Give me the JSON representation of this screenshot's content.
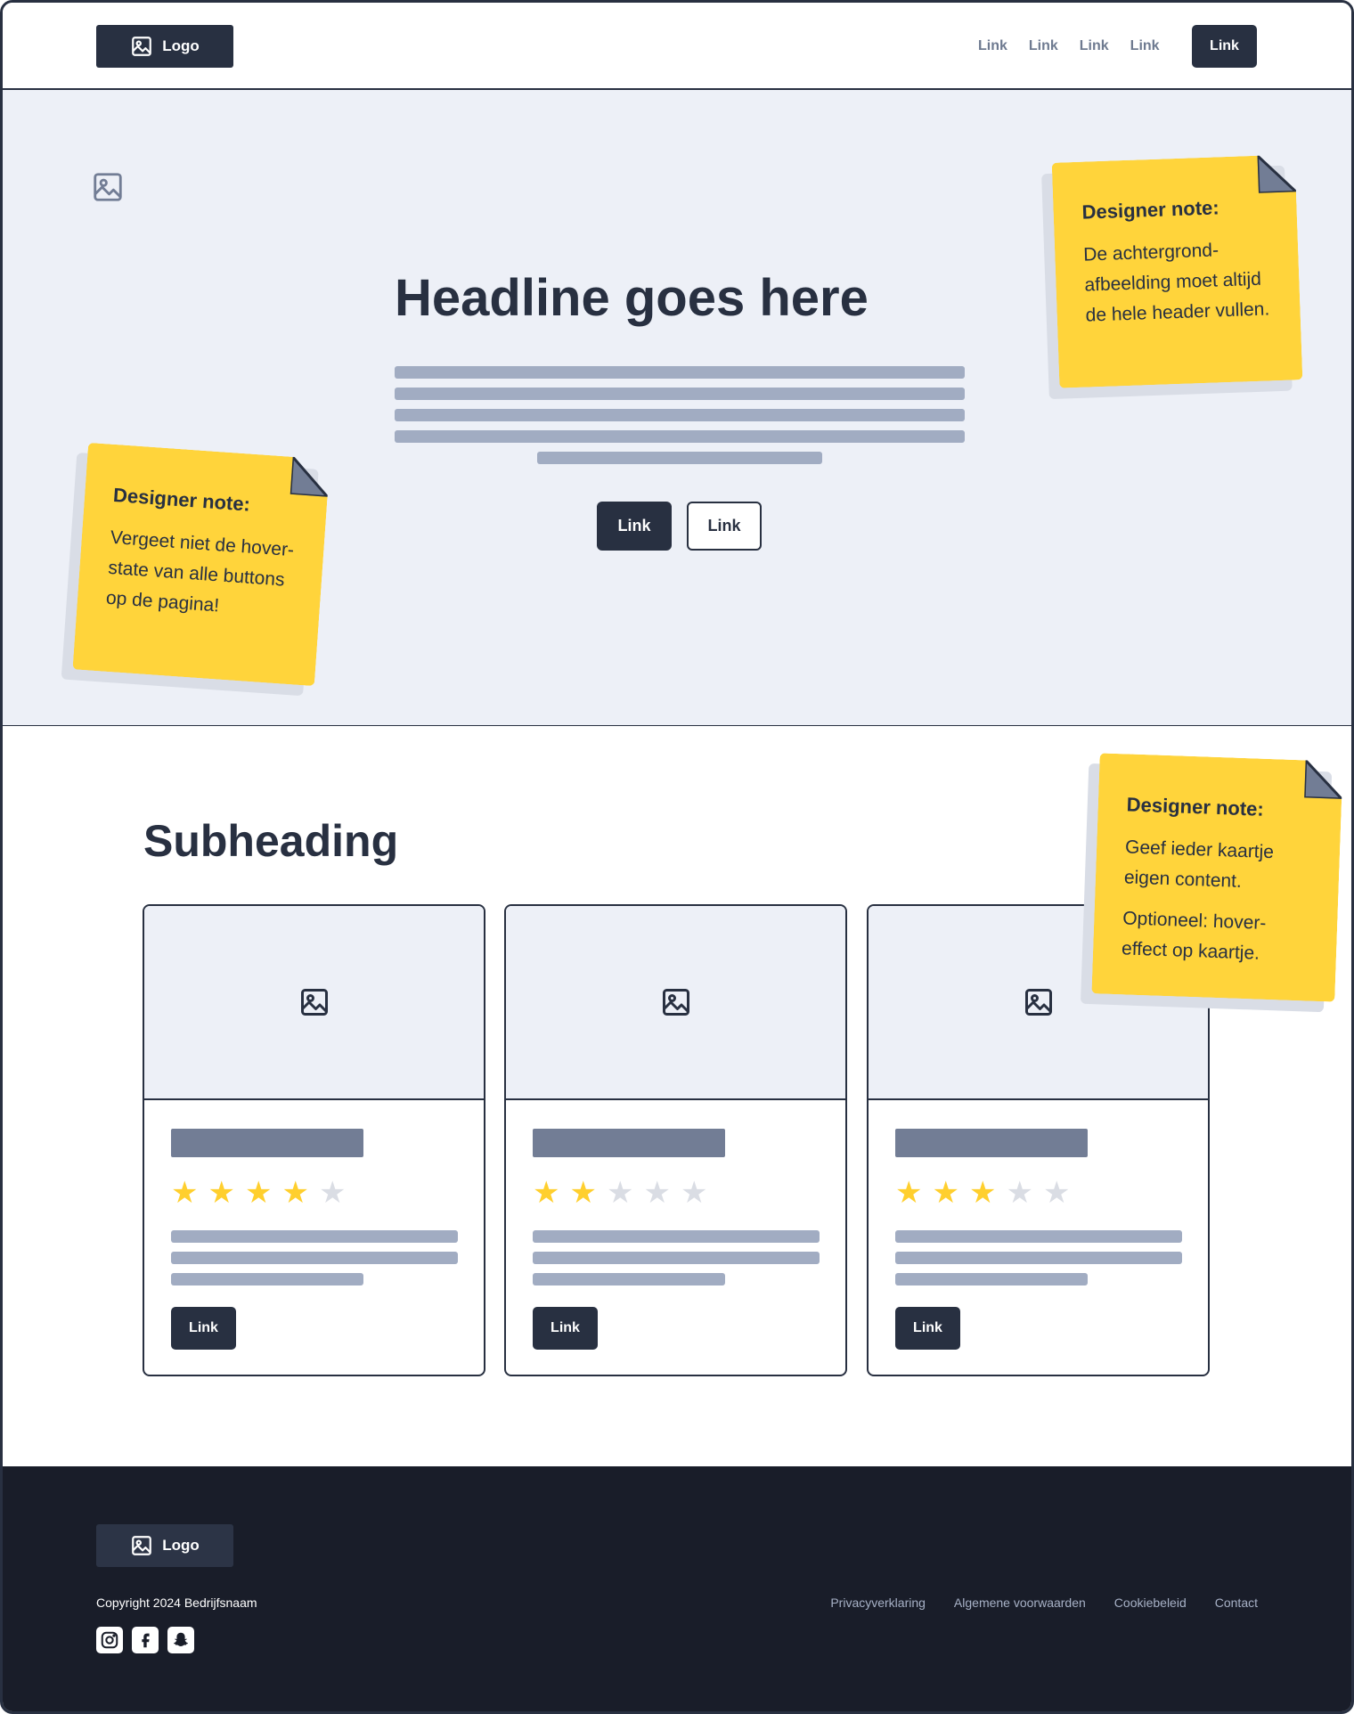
{
  "nav": {
    "logo_label": "Logo",
    "links": [
      "Link",
      "Link",
      "Link",
      "Link"
    ],
    "cta_label": "Link"
  },
  "hero": {
    "headline": "Headline goes here",
    "primary_button": "Link",
    "secondary_button": "Link"
  },
  "notes": [
    {
      "title": "Designer note:",
      "paragraphs": [
        "De achtergrond-afbeelding moet altijd de hele header vullen."
      ]
    },
    {
      "title": "Designer note:",
      "paragraphs": [
        "Vergeet niet de hover-state van alle buttons op de pagina!"
      ]
    },
    {
      "title": "Designer note:",
      "paragraphs": [
        "Geef ieder kaartje eigen content.",
        "Optioneel: hover-effect op kaartje."
      ]
    }
  ],
  "content": {
    "subheading": "Subheading",
    "cards": [
      {
        "rating": 4,
        "max_rating": 5,
        "button_label": "Link"
      },
      {
        "rating": 2,
        "max_rating": 5,
        "button_label": "Link"
      },
      {
        "rating": 3,
        "max_rating": 5,
        "button_label": "Link"
      }
    ]
  },
  "footer": {
    "logo_label": "Logo",
    "copyright": "Copyright 2024 Bedrijfsnaam",
    "links": [
      "Privacyverklaring",
      "Algemene voorwaarden",
      "Cookiebeleid",
      "Contact"
    ],
    "socials": [
      "instagram-icon",
      "facebook-icon",
      "snapchat-icon"
    ]
  },
  "colors": {
    "primary": "#283041",
    "hero_bg": "#edf0f7",
    "note_yellow": "#ffd43b",
    "star_on": "#ffcf2e",
    "star_off": "#dadde4",
    "footer_bg": "#191d29"
  }
}
